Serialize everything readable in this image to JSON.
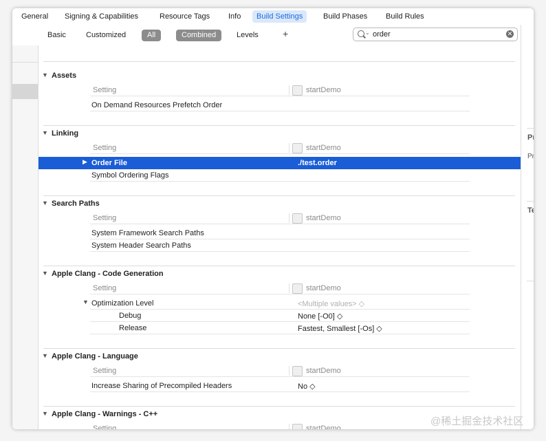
{
  "tabs": [
    "General",
    "Signing & Capabilities",
    "Resource Tags",
    "Info",
    "Build Settings",
    "Build Phases",
    "Build Rules"
  ],
  "filter": {
    "basic": "Basic",
    "customized": "Customized",
    "all": "All",
    "combined": "Combined",
    "levels": "Levels",
    "plus": "+"
  },
  "search": {
    "value": "order",
    "clear": "✕"
  },
  "table": {
    "setting_label": "Setting",
    "target": "startDemo"
  },
  "sections": {
    "assets": {
      "title": "Assets",
      "rows": [
        {
          "label": "On Demand Resources Prefetch Order",
          "value": ""
        }
      ]
    },
    "linking": {
      "title": "Linking",
      "rows": [
        {
          "label": "Order File",
          "value": "./test.order"
        },
        {
          "label": "Symbol Ordering Flags",
          "value": ""
        }
      ]
    },
    "search_paths": {
      "title": "Search Paths",
      "rows": [
        {
          "label": "System Framework Search Paths",
          "value": ""
        },
        {
          "label": "System Header Search Paths",
          "value": ""
        }
      ]
    },
    "clang_codegen": {
      "title": "Apple Clang - Code Generation",
      "rows": [
        {
          "label": "Optimization Level",
          "value": "<Multiple values> ◇"
        },
        {
          "label": "Debug",
          "value": "None [-O0] ◇"
        },
        {
          "label": "Release",
          "value": "Fastest, Smallest [-Os] ◇"
        }
      ]
    },
    "clang_language": {
      "title": "Apple Clang - Language",
      "rows": [
        {
          "label": "Increase Sharing of Precompiled Headers",
          "value": "No ◇"
        }
      ]
    },
    "clang_warnings": {
      "title": "Apple Clang - Warnings - C++"
    }
  },
  "right_panel": {
    "label1": "Pr",
    "label2": "Pr",
    "label3": "Te"
  },
  "watermark": "@稀土掘金技术社区"
}
